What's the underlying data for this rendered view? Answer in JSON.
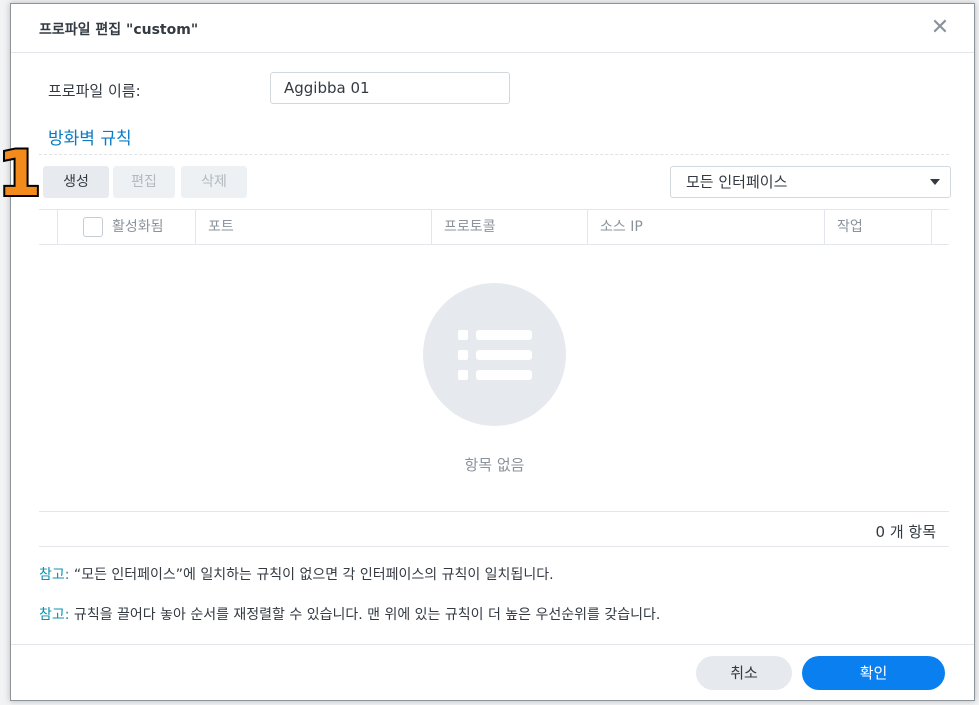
{
  "dialog": {
    "title": "프로파일 편집 \"custom\"",
    "close_icon": "close-icon"
  },
  "profile": {
    "name_label": "프로파일 이름:",
    "name_value": "Aggibba 01"
  },
  "rules": {
    "section_title": "방화벽 규칙",
    "annotation_number": "1",
    "toolbar": {
      "create_label": "생성",
      "edit_label": "편집",
      "delete_label": "삭제"
    },
    "interface_select": {
      "selected": "모든 인터페이스"
    },
    "table": {
      "columns": [
        "활성화됨",
        "포트",
        "프로토콜",
        "소스 IP",
        "작업"
      ]
    },
    "empty_icon": "list-icon",
    "empty_text": "항목 없음",
    "item_count": "0 개 항목"
  },
  "notes": [
    {
      "prefix": "참고:",
      "text": " “모든 인터페이스”에 일치하는 규칙이 없으면 각 인터페이스의 규칙이 일치됩니다."
    },
    {
      "prefix": "참고:",
      "text": " 규칙을 끌어다 놓아 순서를 재정렬할 수 있습니다. 맨 위에 있는 규칙이 더 높은 우선순위를 갖습니다."
    }
  ],
  "footer": {
    "cancel_label": "취소",
    "ok_label": "확인"
  },
  "colors": {
    "accent": "#0a7ff0",
    "section_title": "#0c7bc4",
    "note_prefix": "#0c8fb0",
    "annotation": "#f28a1c"
  }
}
